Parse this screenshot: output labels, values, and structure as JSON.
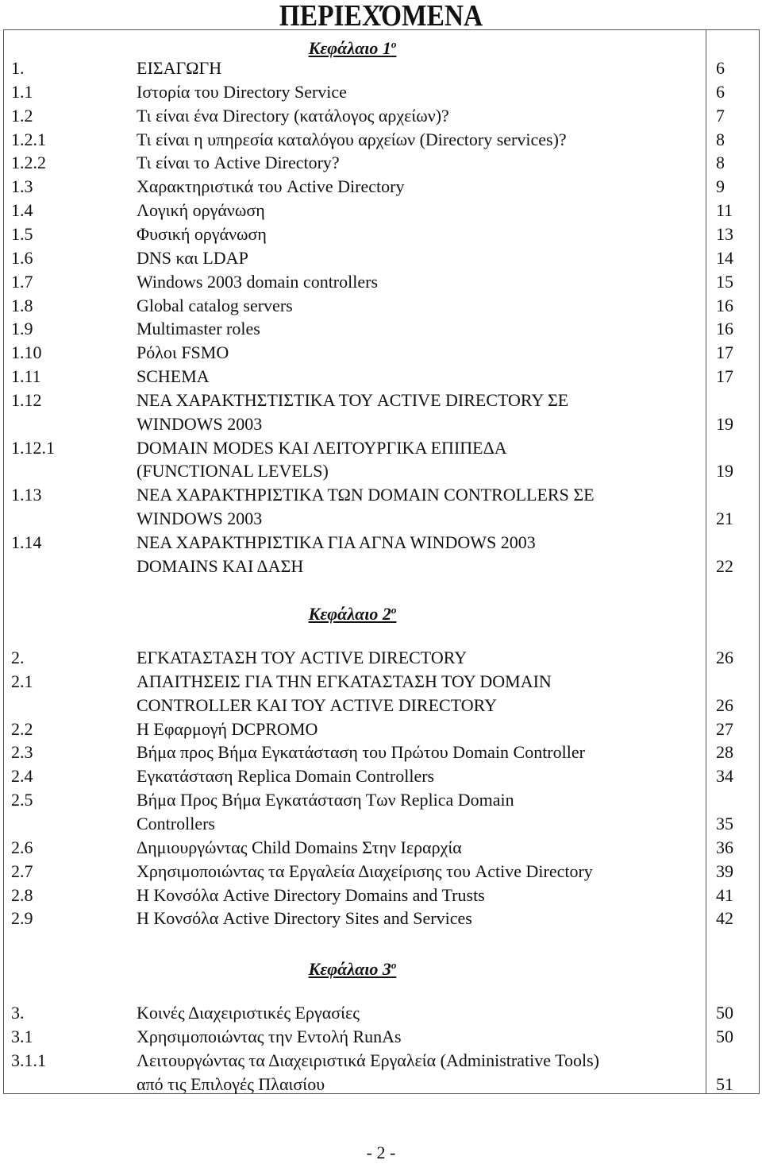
{
  "document": {
    "title": "ΠΕΡΙΕΧΌΜΕΝΑ",
    "page_footer": "- 2 -"
  },
  "chapters": [
    {
      "heading": "Κεφάλαιο 1",
      "heading_sup": "ο",
      "entries": [
        {
          "num": "1.",
          "lines": [
            "ΕΙΣΑΓΩΓΗ"
          ],
          "page": "6"
        },
        {
          "num": "1.1",
          "lines": [
            "Ιστορία του Directory Service"
          ],
          "page": "6"
        },
        {
          "num": "1.2",
          "lines": [
            "Τι είναι ένα Directory (κατάλογος αρχείων)?"
          ],
          "page": "7"
        },
        {
          "num": "1.2.1",
          "lines": [
            "Τι είναι η υπηρεσία καταλόγου αρχείων (Directory services)?"
          ],
          "page": "8"
        },
        {
          "num": "1.2.2",
          "lines": [
            "Τι είναι το Active Directory?"
          ],
          "page": "8"
        },
        {
          "num": "1.3",
          "lines": [
            "Χαρακτηριστικά του Active Directory"
          ],
          "page": "9"
        },
        {
          "num": "1.4",
          "lines": [
            "Λογική οργάνωση"
          ],
          "page": "11"
        },
        {
          "num": "1.5",
          "lines": [
            "Φυσική οργάνωση"
          ],
          "page": "13"
        },
        {
          "num": "1.6",
          "lines": [
            "DNS και LDAP"
          ],
          "page": "14"
        },
        {
          "num": "1.7",
          "lines": [
            "Windows 2003 domain controllers"
          ],
          "page": "15"
        },
        {
          "num": "1.8",
          "lines": [
            "Global catalog servers"
          ],
          "page": "16"
        },
        {
          "num": "1.9",
          "lines": [
            "Multimaster roles"
          ],
          "page": "16"
        },
        {
          "num": "1.10",
          "lines": [
            "Ρόλοι FSMO"
          ],
          "page": "17"
        },
        {
          "num": "1.11",
          "lines": [
            "SCHEMA"
          ],
          "page": "17"
        },
        {
          "num": "1.12",
          "lines": [
            "ΝΕΑ ΧΑΡΑΚΤΗΣΤΙΣΤΙΚΑ ΤΟΥ ACTIVE DIRECTORY ΣΕ",
            "WINDOWS 2003"
          ],
          "page": "19"
        },
        {
          "num": "1.12.1",
          "lines": [
            "DOMAIN MODES ΚΑΙ ΛΕΙΤΟΥΡΓΙΚΑ ΕΠΙΠΕΔΑ",
            "(FUNCTIONAL LEVELS)"
          ],
          "page": "19"
        },
        {
          "num": "1.13",
          "lines": [
            "ΝΕΑ ΧΑΡΑΚΤΗΡΙΣΤΙΚΑ ΤΩΝ DOMAIN CONTROLLERS ΣΕ",
            "WINDOWS 2003"
          ],
          "page": "21"
        },
        {
          "num": "1.14",
          "lines": [
            "ΝΕΑ ΧΑΡΑΚΤΗΡΙΣΤΙΚΑ ΓΙΑ ΑΓΝΑ WINDOWS 2003",
            "DOMAINS ΚΑΙ ΔΑΣΗ"
          ],
          "page": "22"
        }
      ]
    },
    {
      "heading": "Κεφάλαιο 2",
      "heading_sup": "ο",
      "entries": [
        {
          "num": "2.",
          "lines": [
            "ΕΓΚΑΤΑΣΤΑΣΗ ΤΟΥ ACTIVE DIRECTORY"
          ],
          "page": "26"
        },
        {
          "num": "2.1",
          "lines": [
            "ΑΠΑΙΤΗΣΕΙΣ ΓΙΑ ΤΗΝ ΕΓΚΑΤΑΣΤΑΣΗ ΤΟΥ DOMAIN",
            "CONTROLLER ΚΑΙ ΤΟΥ ACTIVE DIRECTORY"
          ],
          "page": "26"
        },
        {
          "num": "2.2",
          "lines": [
            "Η Εφαρμογή DCPROMO"
          ],
          "page": "27"
        },
        {
          "num": "2.3",
          "lines": [
            "Βήμα προς Βήμα Εγκατάσταση του Πρώτου Domain Controller"
          ],
          "page": "28"
        },
        {
          "num": "2.4",
          "lines": [
            "Εγκατάσταση Replica Domain Controllers"
          ],
          "page": "34"
        },
        {
          "num": "2.5",
          "lines": [
            "Βήμα Προς Βήμα Εγκατάσταση Των Replica Domain",
            "Controllers"
          ],
          "page": "35"
        },
        {
          "num": "2.6",
          "lines": [
            "Δημιουργώντας Child Domains Στην Ιεραρχία"
          ],
          "page": "36"
        },
        {
          "num": "2.7",
          "lines": [
            "Χρησιμοποιώντας τα Εργαλεία Διαχείρισης του Active Directory"
          ],
          "page": "39"
        },
        {
          "num": "2.8",
          "lines": [
            "Η Κονσόλα Active Directory Domains and Trusts"
          ],
          "page": "41"
        },
        {
          "num": "2.9",
          "lines": [
            "Η Κονσόλα Active Directory Sites and Services"
          ],
          "page": "42"
        }
      ]
    },
    {
      "heading": "Κεφάλαιο 3",
      "heading_sup": "ο",
      "entries": [
        {
          "num": "3.",
          "lines": [
            "Κοινές Διαχειριστικές Εργασίες"
          ],
          "page": "50"
        },
        {
          "num": "3.1",
          "lines": [
            "Χρησιμοποιώντας την Εντολή RunAs"
          ],
          "page": "50"
        },
        {
          "num": "3.1.1",
          "lines": [
            "Λειτουργώντας τα Διαχειριστικά Εργαλεία (Administrative Tools)",
            "από τις Επιλογές Πλαισίου"
          ],
          "page": "51"
        }
      ]
    }
  ]
}
